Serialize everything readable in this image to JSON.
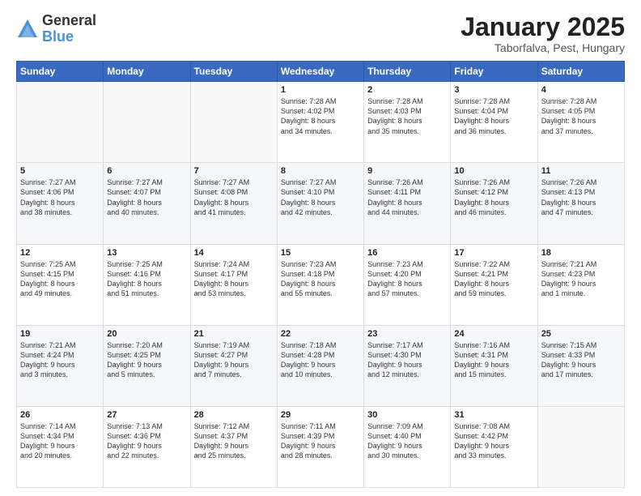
{
  "logo": {
    "general": "General",
    "blue": "Blue"
  },
  "header": {
    "month": "January 2025",
    "location": "Taborfalva, Pest, Hungary"
  },
  "days_of_week": [
    "Sunday",
    "Monday",
    "Tuesday",
    "Wednesday",
    "Thursday",
    "Friday",
    "Saturday"
  ],
  "weeks": [
    [
      {
        "day": "",
        "info": ""
      },
      {
        "day": "",
        "info": ""
      },
      {
        "day": "",
        "info": ""
      },
      {
        "day": "1",
        "info": "Sunrise: 7:28 AM\nSunset: 4:02 PM\nDaylight: 8 hours\nand 34 minutes."
      },
      {
        "day": "2",
        "info": "Sunrise: 7:28 AM\nSunset: 4:03 PM\nDaylight: 8 hours\nand 35 minutes."
      },
      {
        "day": "3",
        "info": "Sunrise: 7:28 AM\nSunset: 4:04 PM\nDaylight: 8 hours\nand 36 minutes."
      },
      {
        "day": "4",
        "info": "Sunrise: 7:28 AM\nSunset: 4:05 PM\nDaylight: 8 hours\nand 37 minutes."
      }
    ],
    [
      {
        "day": "5",
        "info": "Sunrise: 7:27 AM\nSunset: 4:06 PM\nDaylight: 8 hours\nand 38 minutes."
      },
      {
        "day": "6",
        "info": "Sunrise: 7:27 AM\nSunset: 4:07 PM\nDaylight: 8 hours\nand 40 minutes."
      },
      {
        "day": "7",
        "info": "Sunrise: 7:27 AM\nSunset: 4:08 PM\nDaylight: 8 hours\nand 41 minutes."
      },
      {
        "day": "8",
        "info": "Sunrise: 7:27 AM\nSunset: 4:10 PM\nDaylight: 8 hours\nand 42 minutes."
      },
      {
        "day": "9",
        "info": "Sunrise: 7:26 AM\nSunset: 4:11 PM\nDaylight: 8 hours\nand 44 minutes."
      },
      {
        "day": "10",
        "info": "Sunrise: 7:26 AM\nSunset: 4:12 PM\nDaylight: 8 hours\nand 46 minutes."
      },
      {
        "day": "11",
        "info": "Sunrise: 7:26 AM\nSunset: 4:13 PM\nDaylight: 8 hours\nand 47 minutes."
      }
    ],
    [
      {
        "day": "12",
        "info": "Sunrise: 7:25 AM\nSunset: 4:15 PM\nDaylight: 8 hours\nand 49 minutes."
      },
      {
        "day": "13",
        "info": "Sunrise: 7:25 AM\nSunset: 4:16 PM\nDaylight: 8 hours\nand 51 minutes."
      },
      {
        "day": "14",
        "info": "Sunrise: 7:24 AM\nSunset: 4:17 PM\nDaylight: 8 hours\nand 53 minutes."
      },
      {
        "day": "15",
        "info": "Sunrise: 7:23 AM\nSunset: 4:18 PM\nDaylight: 8 hours\nand 55 minutes."
      },
      {
        "day": "16",
        "info": "Sunrise: 7:23 AM\nSunset: 4:20 PM\nDaylight: 8 hours\nand 57 minutes."
      },
      {
        "day": "17",
        "info": "Sunrise: 7:22 AM\nSunset: 4:21 PM\nDaylight: 8 hours\nand 59 minutes."
      },
      {
        "day": "18",
        "info": "Sunrise: 7:21 AM\nSunset: 4:23 PM\nDaylight: 9 hours\nand 1 minute."
      }
    ],
    [
      {
        "day": "19",
        "info": "Sunrise: 7:21 AM\nSunset: 4:24 PM\nDaylight: 9 hours\nand 3 minutes."
      },
      {
        "day": "20",
        "info": "Sunrise: 7:20 AM\nSunset: 4:25 PM\nDaylight: 9 hours\nand 5 minutes."
      },
      {
        "day": "21",
        "info": "Sunrise: 7:19 AM\nSunset: 4:27 PM\nDaylight: 9 hours\nand 7 minutes."
      },
      {
        "day": "22",
        "info": "Sunrise: 7:18 AM\nSunset: 4:28 PM\nDaylight: 9 hours\nand 10 minutes."
      },
      {
        "day": "23",
        "info": "Sunrise: 7:17 AM\nSunset: 4:30 PM\nDaylight: 9 hours\nand 12 minutes."
      },
      {
        "day": "24",
        "info": "Sunrise: 7:16 AM\nSunset: 4:31 PM\nDaylight: 9 hours\nand 15 minutes."
      },
      {
        "day": "25",
        "info": "Sunrise: 7:15 AM\nSunset: 4:33 PM\nDaylight: 9 hours\nand 17 minutes."
      }
    ],
    [
      {
        "day": "26",
        "info": "Sunrise: 7:14 AM\nSunset: 4:34 PM\nDaylight: 9 hours\nand 20 minutes."
      },
      {
        "day": "27",
        "info": "Sunrise: 7:13 AM\nSunset: 4:36 PM\nDaylight: 9 hours\nand 22 minutes."
      },
      {
        "day": "28",
        "info": "Sunrise: 7:12 AM\nSunset: 4:37 PM\nDaylight: 9 hours\nand 25 minutes."
      },
      {
        "day": "29",
        "info": "Sunrise: 7:11 AM\nSunset: 4:39 PM\nDaylight: 9 hours\nand 28 minutes."
      },
      {
        "day": "30",
        "info": "Sunrise: 7:09 AM\nSunset: 4:40 PM\nDaylight: 9 hours\nand 30 minutes."
      },
      {
        "day": "31",
        "info": "Sunrise: 7:08 AM\nSunset: 4:42 PM\nDaylight: 9 hours\nand 33 minutes."
      },
      {
        "day": "",
        "info": ""
      }
    ]
  ]
}
